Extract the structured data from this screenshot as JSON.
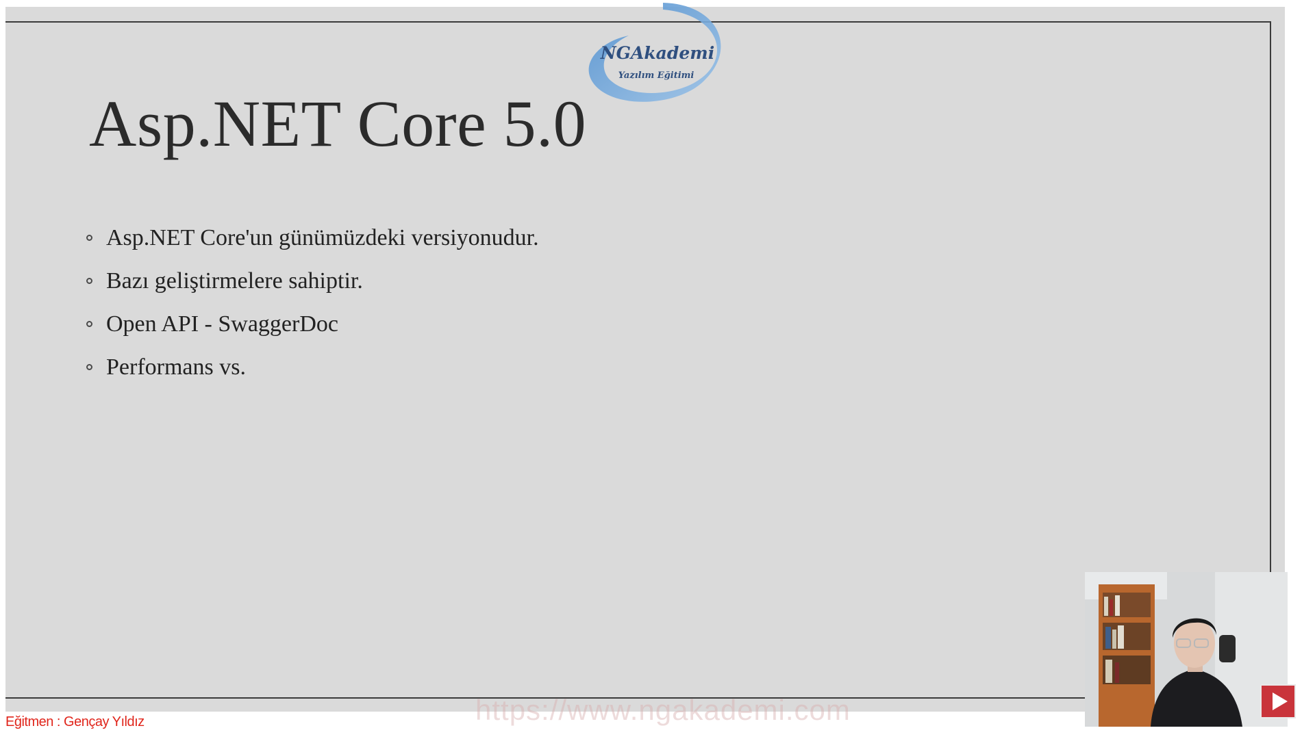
{
  "slide": {
    "title": "Asp.NET Core 5.0",
    "bullets": [
      "Asp.NET Core'un günümüzdeki versiyonudur.",
      "Bazı geliştirmelere sahiptir.",
      "Open API - SwaggerDoc",
      "Performans vs."
    ]
  },
  "logo": {
    "name": "NGAkademi",
    "tagline": "Yazılım Eğitimi",
    "accent_color": "#5b9bd5"
  },
  "overlay": {
    "watermark_url": "https://www.ngakademi.com",
    "instructor_credit": "Eğitmen : Gençay Yıldız",
    "play_button_color": "#c9343b"
  },
  "icons": {
    "bullet": "hollow-circle",
    "play": "play-triangle"
  }
}
